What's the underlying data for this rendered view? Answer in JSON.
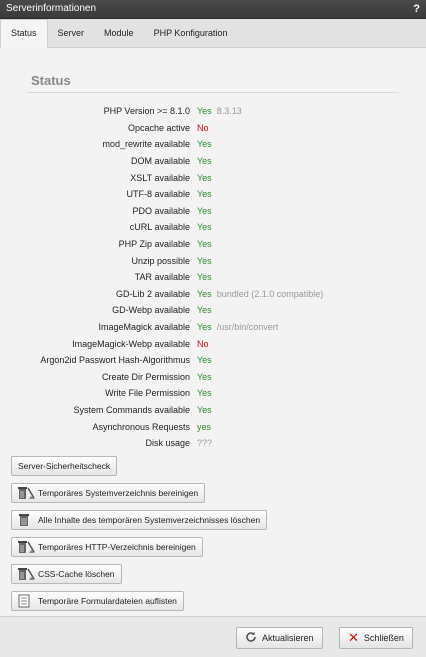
{
  "window": {
    "title": "Serverinformationen",
    "help": "?"
  },
  "tabs": [
    "Status",
    "Server",
    "Module",
    "PHP Konfiguration"
  ],
  "status": {
    "title": "Status",
    "rows": [
      {
        "label": "PHP Version >= 8.1.0",
        "value": "Yes",
        "state": "yes",
        "extra": "8.3.13"
      },
      {
        "label": "Opcache active",
        "value": "No",
        "state": "no",
        "extra": ""
      },
      {
        "label": "mod_rewrite available",
        "value": "Yes",
        "state": "yes",
        "extra": ""
      },
      {
        "label": "DOM available",
        "value": "Yes",
        "state": "yes",
        "extra": ""
      },
      {
        "label": "XSLT available",
        "value": "Yes",
        "state": "yes",
        "extra": ""
      },
      {
        "label": "UTF-8 available",
        "value": "Yes",
        "state": "yes",
        "extra": ""
      },
      {
        "label": "PDO available",
        "value": "Yes",
        "state": "yes",
        "extra": ""
      },
      {
        "label": "cURL available",
        "value": "Yes",
        "state": "yes",
        "extra": ""
      },
      {
        "label": "PHP Zip available",
        "value": "Yes",
        "state": "yes",
        "extra": ""
      },
      {
        "label": "Unzip possible",
        "value": "Yes",
        "state": "yes",
        "extra": ""
      },
      {
        "label": "TAR available",
        "value": "Yes",
        "state": "yes",
        "extra": ""
      },
      {
        "label": "GD-Lib 2 available",
        "value": "Yes",
        "state": "yes",
        "extra": "bundled (2.1.0 compatible)"
      },
      {
        "label": "GD-Webp available",
        "value": "Yes",
        "state": "yes",
        "extra": ""
      },
      {
        "label": "ImageMagick available",
        "value": "Yes",
        "state": "yes",
        "extra": "/usr/bin/convert"
      },
      {
        "label": "ImageMagick-Webp available",
        "value": "No",
        "state": "no",
        "extra": ""
      },
      {
        "label": "Argon2id Passwort Hash-Algorithmus",
        "value": "Yes",
        "state": "yes",
        "extra": ""
      },
      {
        "label": "Create Dir Permission",
        "value": "Yes",
        "state": "yes",
        "extra": ""
      },
      {
        "label": "Write File Permission",
        "value": "Yes",
        "state": "yes",
        "extra": ""
      },
      {
        "label": "System Commands available",
        "value": "Yes",
        "state": "yes",
        "extra": ""
      },
      {
        "label": "Asynchronous Requests",
        "value": "yes",
        "state": "yes",
        "extra": ""
      },
      {
        "label": "Disk usage",
        "value": "???",
        "state": "unk",
        "extra": ""
      }
    ]
  },
  "buttons": [
    {
      "label": "Server-Sicherheitscheck",
      "icon": "none"
    },
    {
      "label": "Temporäres Systemverzeichnis bereinigen",
      "icon": "trash-broom-icon"
    },
    {
      "label": "Alle Inhalte des temporären Systemverzeichnisses löschen",
      "icon": "trash-icon"
    },
    {
      "label": "Temporäres HTTP-Verzeichnis bereinigen",
      "icon": "trash-broom-icon"
    },
    {
      "label": "CSS-Cache löschen",
      "icon": "trash-broom-icon"
    },
    {
      "label": "Temporäre Formulardateien auflisten",
      "icon": "document-list-icon"
    }
  ],
  "footer": {
    "refresh": {
      "label": "Aktualisieren",
      "icon": "refresh-icon"
    },
    "close": {
      "label": "Schließen",
      "icon": "close-icon",
      "color": "#d01010"
    }
  }
}
